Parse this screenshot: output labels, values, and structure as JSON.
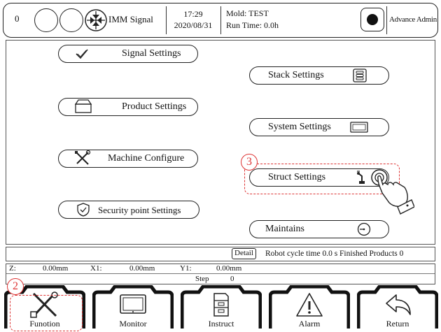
{
  "header": {
    "counter": "0",
    "signal_label": "IMM Signal",
    "time": "17:29",
    "date": "2020/08/31",
    "mold": "Mold: TEST",
    "run_time": "Run Time: 0.0h",
    "user": "Advance Admin"
  },
  "menu": {
    "signal_settings": "Signal Settings",
    "product_settings": "Product Settings",
    "machine_configure": "Machine Configure",
    "security_point_settings": "Security point Settings",
    "stack_settings": "Stack Settings",
    "system_settings": "System Settings",
    "struct_settings": "Struct Settings",
    "maintains": "Maintains"
  },
  "callouts": {
    "struct": "3",
    "function": "2"
  },
  "status": {
    "detail_label": "Detail",
    "cycle_text": "Robot cycle time 0.0 s Finished Products  0"
  },
  "coords": {
    "z_label": "Z:",
    "z_value": "0.00mm",
    "x1_label": "X1:",
    "x1_value": "0.00mm",
    "y1_label": "Y1:",
    "y1_value": "0.00mm",
    "step_label": "Step",
    "step_value": "0"
  },
  "tabs": [
    {
      "label": "Funotion",
      "icon": "tools-icon"
    },
    {
      "label": "Monitor",
      "icon": "monitor-icon"
    },
    {
      "label": "Instruct",
      "icon": "cabinet-icon"
    },
    {
      "label": "Alarm",
      "icon": "warning-icon"
    },
    {
      "label": "Return",
      "icon": "return-arrow-icon"
    }
  ],
  "colors": {
    "callout": "#dd3333",
    "line": "#222222"
  }
}
